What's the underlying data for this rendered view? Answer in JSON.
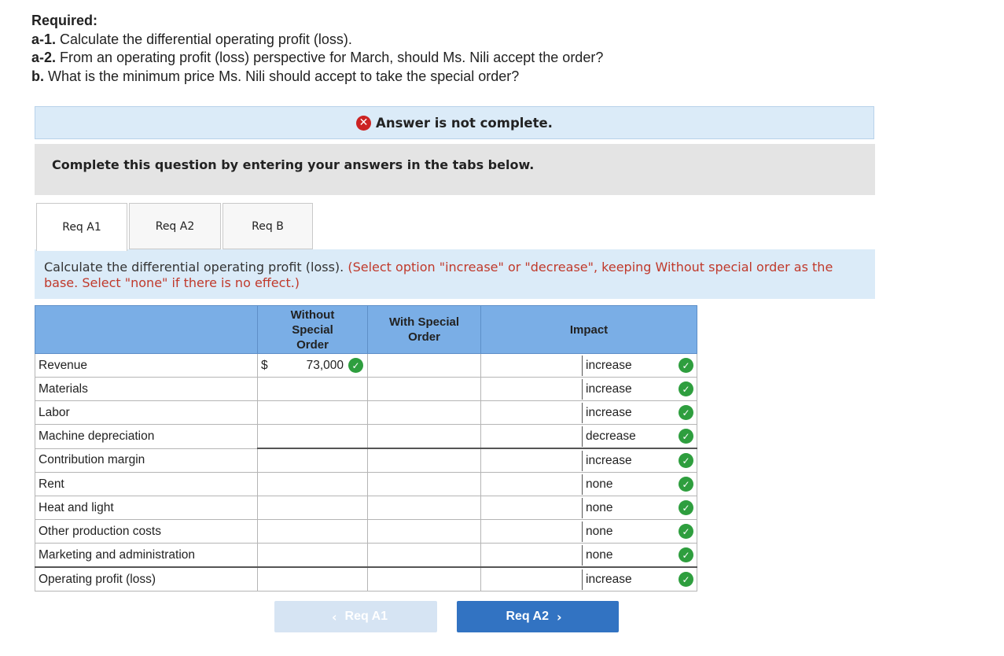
{
  "required": {
    "heading": "Required:",
    "items": [
      {
        "key": "a-1.",
        "text": "Calculate the differential operating profit (loss)."
      },
      {
        "key": "a-2.",
        "text": "From an operating profit (loss) perspective for March, should Ms. Nili accept the order?"
      },
      {
        "key": "b.",
        "text": "What is the minimum price Ms. Nili should accept to take the special order?"
      }
    ]
  },
  "status": {
    "icon": "x-circle-icon",
    "text": "Answer is not complete."
  },
  "instruction": "Complete this question by entering your answers in the tabs below.",
  "tabs": [
    {
      "label": "Req A1",
      "active": true
    },
    {
      "label": "Req A2",
      "active": false
    },
    {
      "label": "Req B",
      "active": false
    }
  ],
  "question": {
    "main": "Calculate the differential operating profit (loss).",
    "note": "(Select option \"increase\" or \"decrease\", keeping Without special order as the base. Select \"none\" if there is no effect.)"
  },
  "table": {
    "headers": {
      "label": "",
      "without": "Without Special Order",
      "with": "With Special Order",
      "impact": "Impact"
    },
    "rows": [
      {
        "label": "Revenue",
        "dollar": "$",
        "without": "73,000",
        "without_check": true,
        "with": "",
        "impact": "increase"
      },
      {
        "label": "Materials",
        "dollar": "",
        "without": "",
        "without_check": false,
        "with": "",
        "impact": "increase"
      },
      {
        "label": "Labor",
        "dollar": "",
        "without": "",
        "without_check": false,
        "with": "",
        "impact": "increase"
      },
      {
        "label": "Machine depreciation",
        "dollar": "",
        "without": "",
        "without_check": false,
        "with": "",
        "impact": "decrease"
      },
      {
        "label": "Contribution margin",
        "dollar": "",
        "without": "",
        "without_check": false,
        "with": "",
        "impact": "increase"
      },
      {
        "label": "Rent",
        "dollar": "",
        "without": "",
        "without_check": false,
        "with": "",
        "impact": "none"
      },
      {
        "label": "Heat and light",
        "dollar": "",
        "without": "",
        "without_check": false,
        "with": "",
        "impact": "none"
      },
      {
        "label": "Other production costs",
        "dollar": "",
        "without": "",
        "without_check": false,
        "with": "",
        "impact": "none"
      },
      {
        "label": "Marketing and administration",
        "dollar": "",
        "without": "",
        "without_check": false,
        "with": "",
        "impact": "none"
      },
      {
        "label": "Operating profit (loss)",
        "dollar": "",
        "without": "",
        "without_check": false,
        "with": "",
        "impact": "increase"
      }
    ]
  },
  "nav": {
    "prev": "Req A1",
    "next": "Req A2",
    "prev_icon": "chevron-left-icon",
    "next_icon": "chevron-right-icon"
  },
  "colors": {
    "header_blue": "#7aaee6",
    "banner_blue": "#dbebf8",
    "next_button": "#3273c2",
    "check_green": "#2e9e3e",
    "error_red": "#cc2222",
    "note_red": "#c0392b"
  }
}
